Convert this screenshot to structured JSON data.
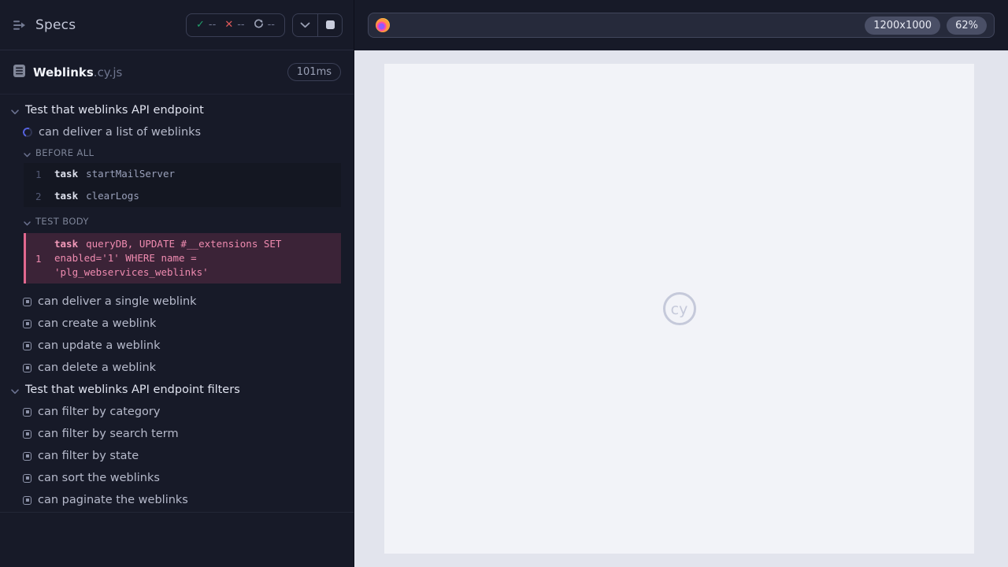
{
  "colors": {
    "pass_green": "#21a06c",
    "fail_red": "#e15a5a",
    "running_blue": "#5663e0",
    "highlight_pink": "#e2688f",
    "sidebar_bg": "#171a28",
    "stage_bg": "#e2e4ed",
    "viewport_bg": "#f2f3f8"
  },
  "sidebar": {
    "header": {
      "title": "Specs",
      "stats": {
        "pass_icon": "✓",
        "passed": "--",
        "fail_icon": "✕",
        "failed": "--",
        "running": "--"
      }
    },
    "spec": {
      "name": "Weblinks",
      "ext": ".cy.js",
      "duration": "101ms"
    }
  },
  "tree": {
    "suite1": {
      "title": "Test that weblinks API endpoint",
      "running_test": "can deliver a list of weblinks",
      "before_all": {
        "label": "BEFORE ALL",
        "logs": [
          {
            "num": "1",
            "cmd": "task",
            "args": "startMailServer"
          },
          {
            "num": "2",
            "cmd": "task",
            "args": "clearLogs"
          }
        ]
      },
      "test_body": {
        "label": "TEST BODY",
        "logs": [
          {
            "num": "1",
            "cmd": "task",
            "args": "queryDB, UPDATE #__extensions SET enabled='1' WHERE name = 'plg_webservices_weblinks'"
          }
        ]
      },
      "tests": [
        "can deliver a single weblink",
        "can create a weblink",
        "can update a weblink",
        "can delete a weblink"
      ]
    },
    "suite2": {
      "title": "Test that weblinks API endpoint filters",
      "tests": [
        "can filter by category",
        "can filter by search term",
        "can filter by state",
        "can sort the weblinks",
        "can paginate the weblinks"
      ]
    }
  },
  "main": {
    "urlbar": {
      "browser": "firefox",
      "viewport_size": "1200x1000",
      "zoom_level": "62%"
    },
    "viewport": {
      "watermark": "cy"
    }
  }
}
